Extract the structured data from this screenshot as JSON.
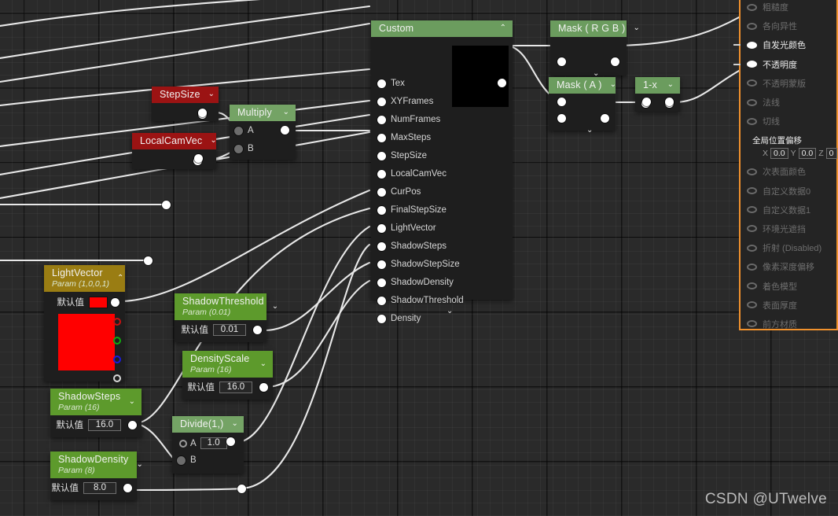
{
  "watermark": "CSDN @UTwelve",
  "labels": {
    "default_value": "默认值"
  },
  "nodes": {
    "custom": {
      "title": "Custom",
      "caret": "⌃",
      "inputs": [
        "Tex",
        "XYFrames",
        "NumFrames",
        "MaxSteps",
        "StepSize",
        "LocalCamVec",
        "CurPos",
        "FinalStepSize",
        "LightVector",
        "ShadowSteps",
        "ShadowStepSize",
        "ShadowDensity",
        "ShadowThreshold",
        "Density"
      ],
      "expand_caret": "⌄"
    },
    "mask_rgb": {
      "title": "Mask ( R G B )",
      "caret": "⌄",
      "expand_caret": "⌄"
    },
    "mask_a": {
      "title": "Mask ( A )",
      "caret": "⌄",
      "expand_caret": "⌄"
    },
    "one_minus_x": {
      "title": "1-x",
      "caret": "⌄"
    },
    "stepsize": {
      "title": "StepSize",
      "caret": "⌄"
    },
    "localcamvec": {
      "title": "LocalCamVec",
      "caret": "⌄"
    },
    "multiply": {
      "title": "Multiply",
      "caret": "⌄",
      "a": "A",
      "b": "B"
    },
    "lightvector": {
      "title": "LightVector",
      "subtitle": "Param (1,0,0,1)",
      "caret": "⌃",
      "default_value": "",
      "color": "#ff0000"
    },
    "shadowthreshold": {
      "title": "ShadowThreshold",
      "subtitle": "Param (0.01)",
      "caret": "⌄",
      "default_value": "0.01"
    },
    "densityscale": {
      "title": "DensityScale",
      "subtitle": "Param (16)",
      "caret": "⌄",
      "default_value": "16.0"
    },
    "shadowsteps": {
      "title": "ShadowSteps",
      "subtitle": "Param (16)",
      "caret": "⌄",
      "default_value": "16.0"
    },
    "shadowdensity": {
      "title": "ShadowDensity",
      "subtitle": "Param (8)",
      "caret": "⌄",
      "default_value": "8.0"
    },
    "divide": {
      "title": "Divide(1,)",
      "caret": "⌄",
      "a": "A",
      "b": "B",
      "a_value": "1.0"
    }
  },
  "details_panel": {
    "rows": [
      {
        "label": "粗糙度",
        "connected": false
      },
      {
        "label": "各向异性",
        "connected": false
      },
      {
        "label": "自发光颜色",
        "connected": true
      },
      {
        "label": "不透明度",
        "connected": true
      },
      {
        "label": "不透明蒙版",
        "connected": false
      },
      {
        "label": "法线",
        "connected": false
      },
      {
        "label": "切线",
        "connected": false
      }
    ],
    "global_position_offset": {
      "label": "全局位置偏移",
      "x_label": "X",
      "x": "0.0",
      "y_label": "Y",
      "y": "0.0",
      "z_label": "Z",
      "z": "0"
    },
    "rows_bottom": [
      {
        "label": "次表面颜色",
        "connected": false
      },
      {
        "label": "自定义数据0",
        "connected": false
      },
      {
        "label": "自定义数据1",
        "connected": false
      },
      {
        "label": "环境光遮挡",
        "connected": false
      },
      {
        "label": "折射 (Disabled)",
        "connected": false
      },
      {
        "label": "像素深度偏移",
        "connected": false
      },
      {
        "label": "着色模型",
        "connected": false
      },
      {
        "label": "表面厚度",
        "connected": false
      },
      {
        "label": "前方材质",
        "connected": false
      }
    ]
  },
  "colors": {
    "node_header_green": "#6b9c5e",
    "param_header_green": "#5d9a2c",
    "reroute_red": "#9b1313",
    "param_gold": "#9a7d13",
    "panel_accent_orange": "#f0912d",
    "canvas": "#2a2a2a"
  }
}
